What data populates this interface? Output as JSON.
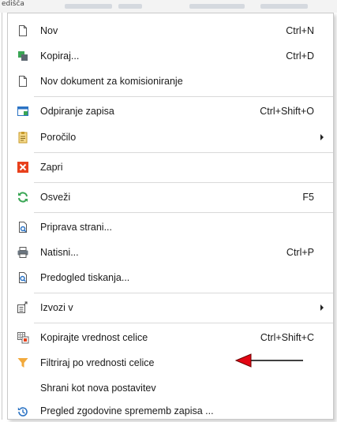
{
  "background": {
    "label": "edišča"
  },
  "menu": {
    "items": [
      {
        "label": "Nov",
        "shortcut": "Ctrl+N",
        "icon": "new-document-icon"
      },
      {
        "label": "Kopiraj...",
        "shortcut": "Ctrl+D",
        "icon": "copy-icon"
      },
      {
        "label": "Nov dokument za komisioniranje",
        "shortcut": "",
        "icon": "new-picking-document-icon"
      },
      {
        "label": "Odpiranje zapisa",
        "shortcut": "Ctrl+Shift+O",
        "icon": "open-record-icon"
      },
      {
        "label": "Poročilo",
        "shortcut": "",
        "icon": "report-icon",
        "submenu": true
      },
      {
        "label": "Zapri",
        "shortcut": "",
        "icon": "close-icon"
      },
      {
        "label": "Osveži",
        "shortcut": "F5",
        "icon": "refresh-icon"
      },
      {
        "label": "Priprava strani...",
        "shortcut": "",
        "icon": "page-setup-icon"
      },
      {
        "label": "Natisni...",
        "shortcut": "Ctrl+P",
        "icon": "print-icon"
      },
      {
        "label": "Predogled tiskanja...",
        "shortcut": "",
        "icon": "print-preview-icon"
      },
      {
        "label": "Izvozi v",
        "shortcut": "",
        "icon": "export-icon",
        "submenu": true
      },
      {
        "label": "Kopirajte vrednost celice",
        "shortcut": "Ctrl+Shift+C",
        "icon": "copy-cell-value-icon"
      },
      {
        "label": "Filtriraj po vrednosti celice",
        "shortcut": "",
        "icon": "filter-icon"
      },
      {
        "label": "Shrani kot nova postavitev",
        "shortcut": "",
        "icon": ""
      },
      {
        "label": "Pregled zgodovine sprememb zapisa ...",
        "shortcut": "",
        "icon": "history-icon"
      }
    ]
  },
  "colors": {
    "accent_green": "#3aa655",
    "accent_blue": "#2b73c4",
    "close_red": "#e8401c",
    "filter_orange": "#f2a93b",
    "annotation_red": "#e30613"
  }
}
